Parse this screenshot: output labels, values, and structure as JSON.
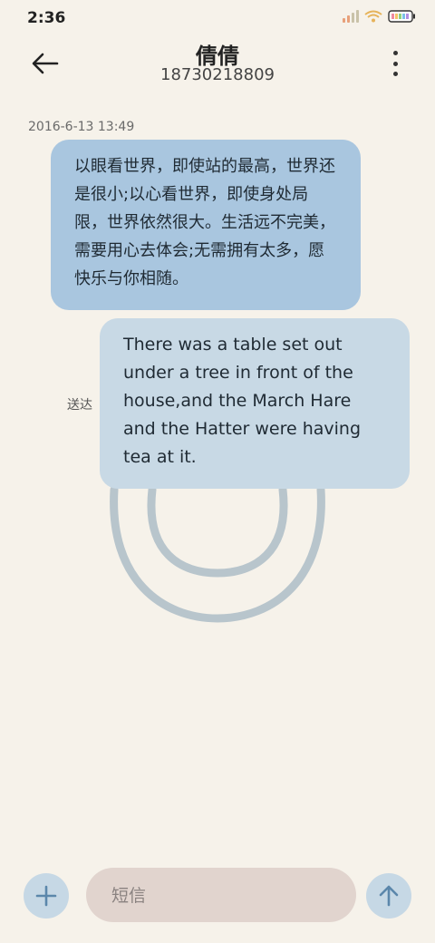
{
  "status_bar": {
    "time": "2:36"
  },
  "header": {
    "contact_name": "倩倩",
    "phone_number": "18730218809"
  },
  "conversation": {
    "timestamp": "2016-6-13 13:49",
    "messages": [
      {
        "direction": "incoming",
        "text": "以眼看世界，即使站的最高，世界还是很小;以心看世界，即使身处局限，世界依然很大。生活远不完美，需要用心去体会;无需拥有太多，愿快乐与你相随。"
      },
      {
        "direction": "outgoing",
        "text": "There was a table set out under a tree in front of the house,and the March Hare and the Hatter were having tea at it.",
        "status": "送达"
      }
    ]
  },
  "composer": {
    "placeholder": "短信"
  },
  "icons": {
    "back": "arrow-left-icon",
    "menu": "more-vertical-icon",
    "add": "plus-icon",
    "send": "arrow-up-icon"
  },
  "colors": {
    "background": "#f6f2ea",
    "incoming_bubble": "#a9c6df",
    "outgoing_bubble": "#c8d9e5",
    "input_background": "#e1d4ce",
    "accent": "#5b87ab"
  }
}
